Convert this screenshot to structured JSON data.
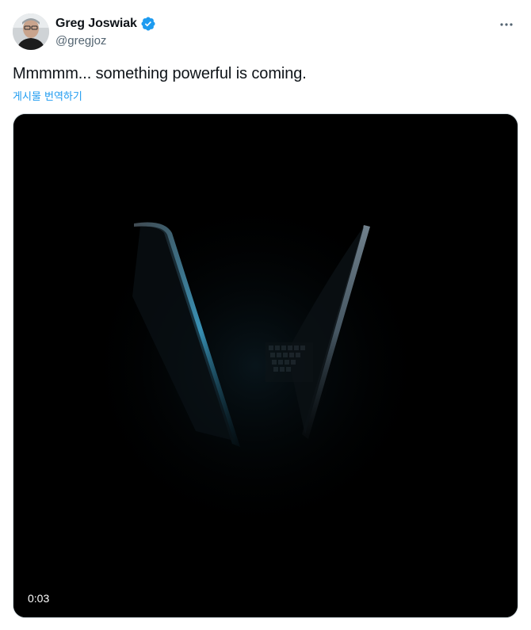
{
  "author": {
    "display_name": "Greg Joswiak",
    "handle": "@gregjoz",
    "verified": true,
    "verified_icon": "verified-badge-icon",
    "verified_color": "#1d9bf0"
  },
  "tweet": {
    "text": "Mmmmm... something powerful is coming.",
    "translate_label": "게시물 번역하기"
  },
  "media": {
    "type": "video",
    "time_display": "0:03"
  },
  "menu": {
    "icon": "more-icon"
  },
  "colors": {
    "link": "#1d9bf0",
    "secondary_text": "#536471",
    "primary_text": "#0f1419"
  }
}
